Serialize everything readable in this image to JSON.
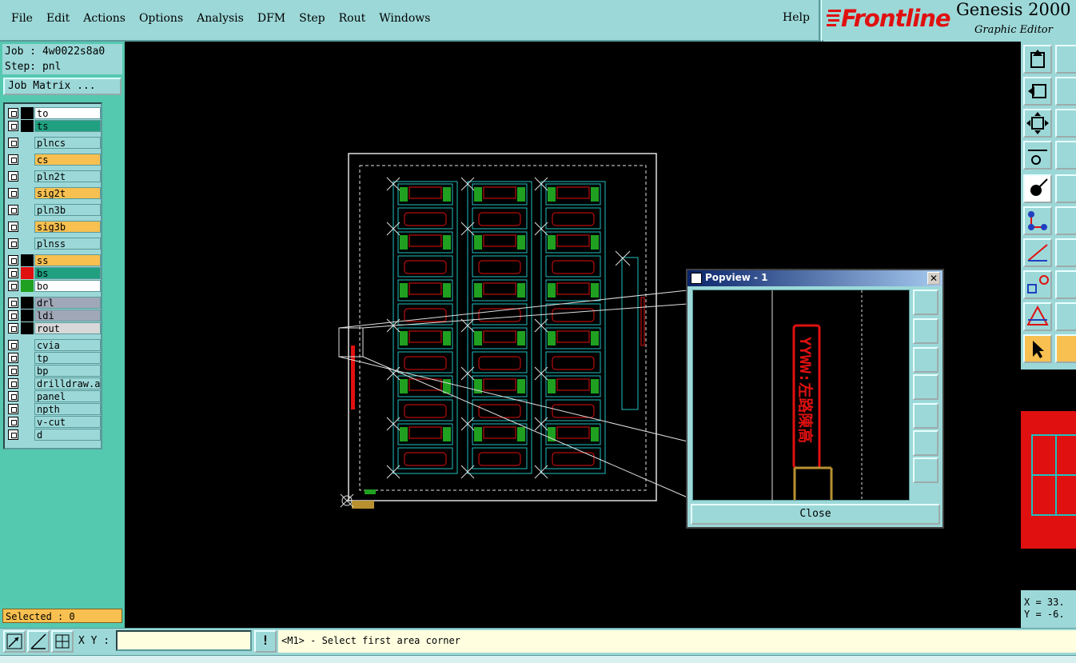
{
  "menubar": {
    "items": [
      "File",
      "Edit",
      "Actions",
      "Options",
      "Analysis",
      "DFM",
      "Step",
      "Rout",
      "Windows"
    ],
    "help": "Help"
  },
  "brand": {
    "logo": "Frontline",
    "product": "Genesis 2000",
    "subtitle": "Graphic Editor"
  },
  "job": {
    "job_line": "Job : 4w0022s8a0",
    "step_line": "Step: pnl",
    "matrix_button": "Job Matrix ..."
  },
  "layers": [
    {
      "name": "to",
      "swatch": "#000000",
      "bg": "#ffffff"
    },
    {
      "name": "ts",
      "swatch": "#000000",
      "bg": "#20a080"
    },
    {
      "name": "plncs",
      "swatch": "#9dd8d8",
      "bg": "#9dd8d8"
    },
    {
      "name": "cs",
      "swatch": "#9dd8d8",
      "bg": "#f8c050"
    },
    {
      "name": "pln2t",
      "swatch": "#9dd8d8",
      "bg": "#9dd8d8"
    },
    {
      "name": "sig2t",
      "swatch": "#9dd8d8",
      "bg": "#f8c050"
    },
    {
      "name": "pln3b",
      "swatch": "#9dd8d8",
      "bg": "#9dd8d8"
    },
    {
      "name": "sig3b",
      "swatch": "#9dd8d8",
      "bg": "#f8c050"
    },
    {
      "name": "plnss",
      "swatch": "#9dd8d8",
      "bg": "#9dd8d8"
    },
    {
      "name": "ss",
      "swatch": "#000000",
      "bg": "#f8c050"
    },
    {
      "name": "bs",
      "swatch": "#e01010",
      "bg": "#20a080"
    },
    {
      "name": "bo",
      "swatch": "#20a020",
      "bg": "#ffffff"
    },
    {
      "name": "drl",
      "swatch": "#000000",
      "bg": "#a0a8b8"
    },
    {
      "name": "ldi",
      "swatch": "#000000",
      "bg": "#a0a8b8"
    },
    {
      "name": "rout",
      "swatch": "#000000",
      "bg": "#d8d8d8"
    },
    {
      "name": "cvia",
      "swatch": "#9dd8d8",
      "bg": "#9dd8d8"
    },
    {
      "name": "tp",
      "swatch": "#9dd8d8",
      "bg": "#9dd8d8"
    },
    {
      "name": "bp",
      "swatch": "#9dd8d8",
      "bg": "#9dd8d8"
    },
    {
      "name": "drilldraw.ar",
      "swatch": "#9dd8d8",
      "bg": "#9dd8d8"
    },
    {
      "name": "panel",
      "swatch": "#9dd8d8",
      "bg": "#9dd8d8"
    },
    {
      "name": "npth",
      "swatch": "#9dd8d8",
      "bg": "#9dd8d8"
    },
    {
      "name": "v-cut",
      "swatch": "#9dd8d8",
      "bg": "#9dd8d8"
    },
    {
      "name": "d",
      "swatch": "#9dd8d8",
      "bg": "#9dd8d8"
    }
  ],
  "selected": "Selected : 0",
  "coords": {
    "x": "X = 33.",
    "y": "Y = -6."
  },
  "bottom": {
    "xy_label": "X Y :",
    "xy_value": "",
    "msg_button": "!",
    "message": "<M1> - Select first area corner"
  },
  "popview": {
    "title": "Popview - 1",
    "close_x": "✕",
    "close_button": "Close",
    "preview_text": "YYWW:左路陳高"
  },
  "colors": {
    "ui": "#9dd8d8",
    "panel": "#55c8b0",
    "highlight": "#f8c050",
    "feature_red": "#e01010",
    "feature_cyan": "#20c0c0",
    "feature_green": "#20a020"
  }
}
